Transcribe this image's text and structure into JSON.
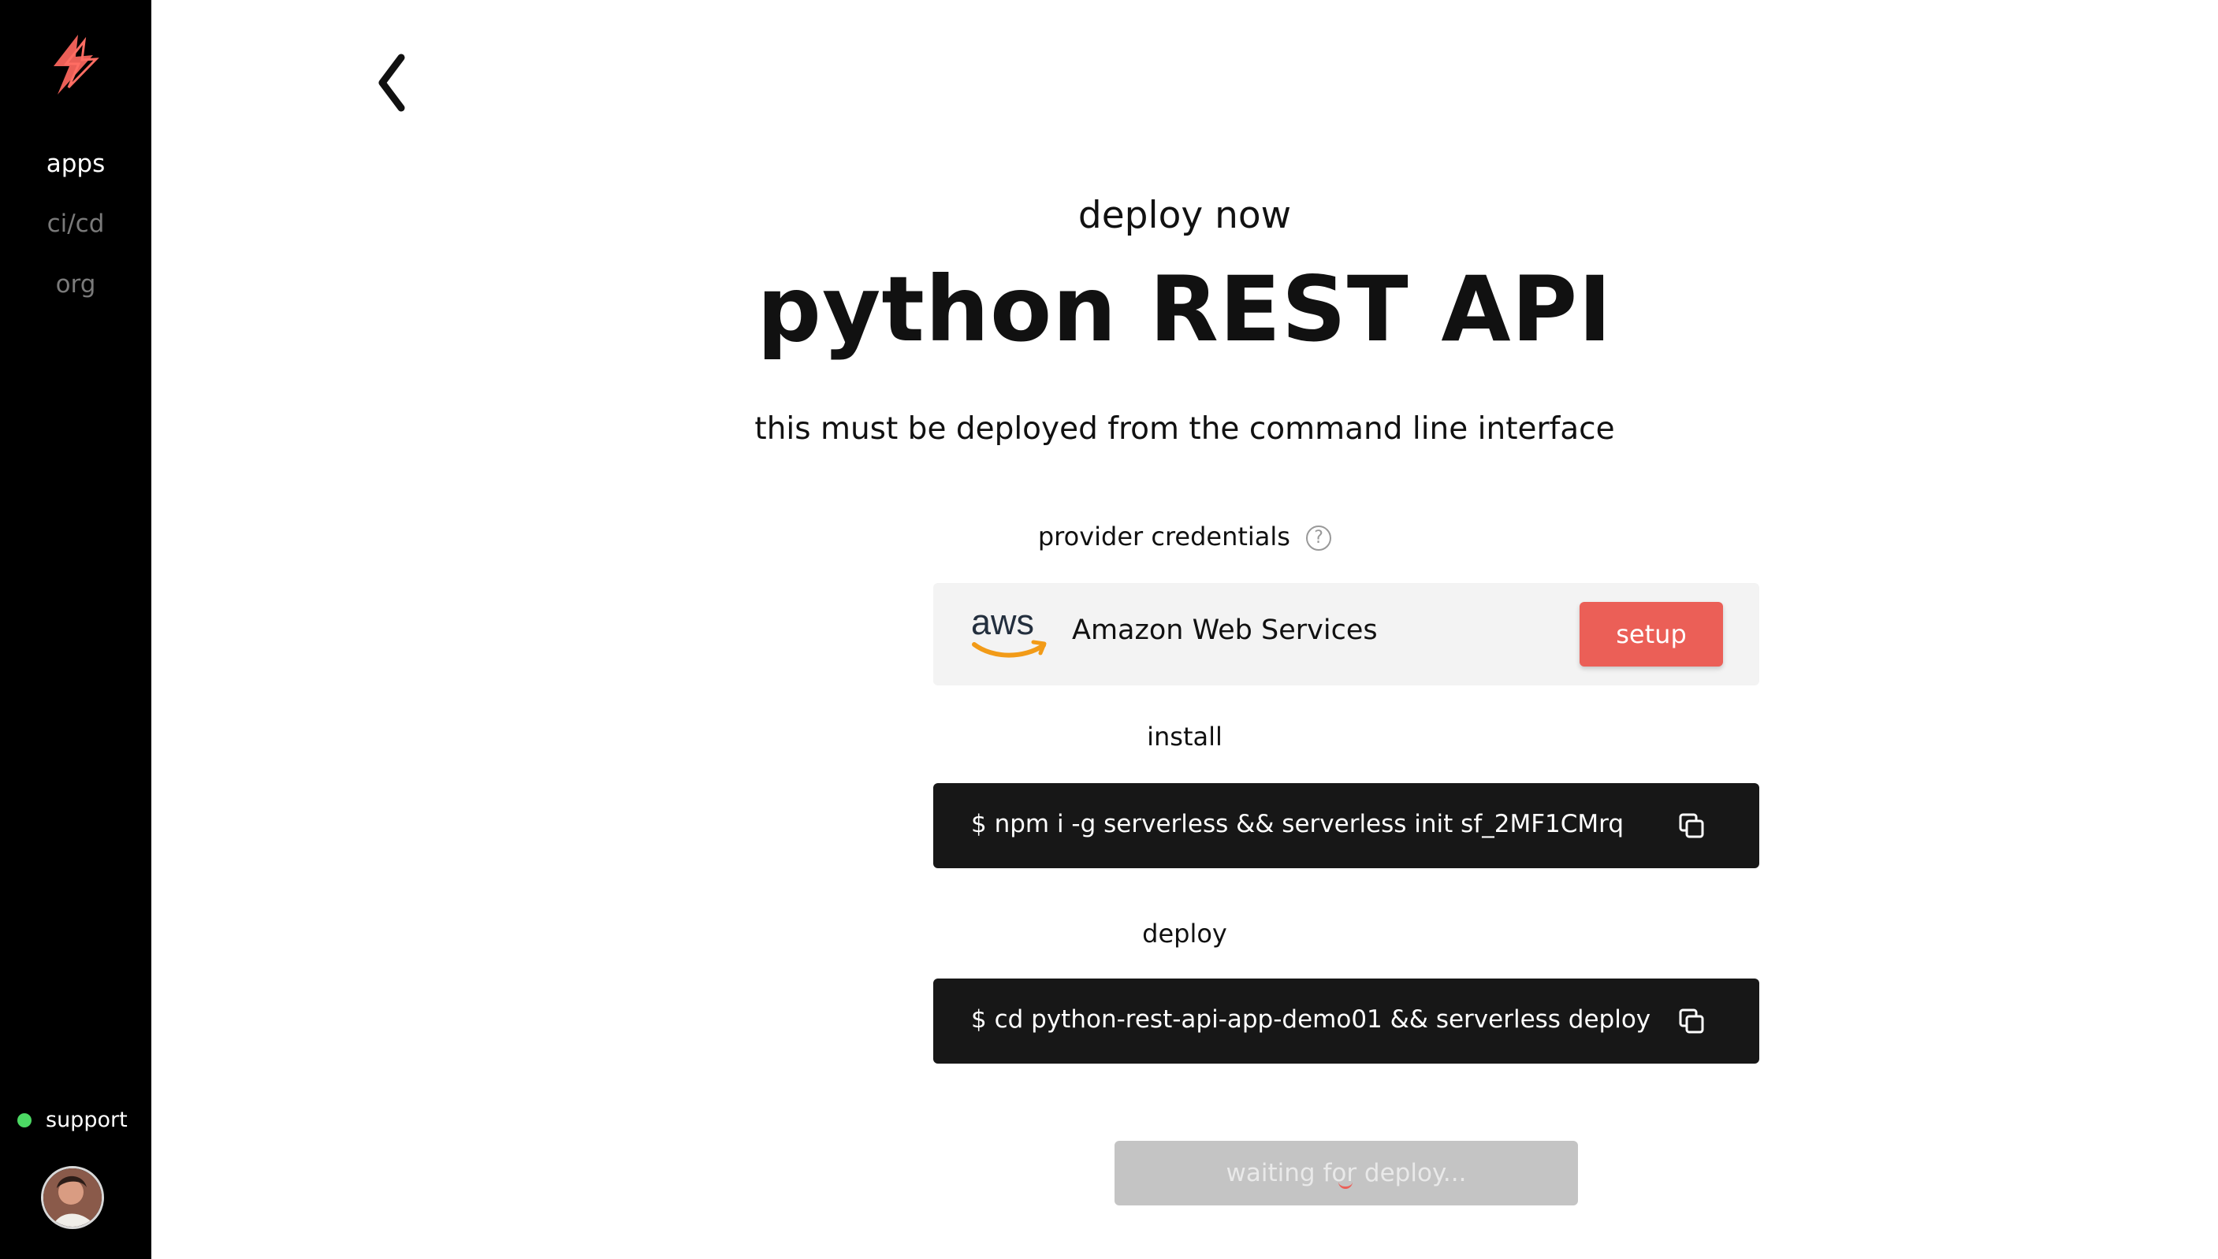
{
  "sidebar": {
    "items": [
      {
        "label": "apps",
        "active": true
      },
      {
        "label": "ci/cd",
        "active": false
      },
      {
        "label": "org",
        "active": false
      }
    ],
    "support_label": "support",
    "support_status_color": "#4cd964"
  },
  "header": {
    "eyebrow": "deploy now",
    "title": "python REST API",
    "subtitle": "this must be deployed from the command line interface"
  },
  "credentials": {
    "label": "provider credentials",
    "help_icon": "question-circle-icon",
    "provider_logo_text": "aws",
    "provider_name": "Amazon Web Services",
    "setup_label": "setup"
  },
  "install": {
    "label": "install",
    "command": "$  npm i -g serverless && serverless init sf_2MF1CMrq"
  },
  "deploy": {
    "label": "deploy",
    "command": "$  cd python-rest-api-app-demo01 && serverless deploy"
  },
  "status_button": {
    "label": "waiting for deploy..."
  },
  "colors": {
    "accent": "#eb5f57",
    "sidebar_bg": "#000000",
    "command_bg": "#171717",
    "card_bg": "#f3f3f3",
    "aws_orange": "#f29b18"
  }
}
